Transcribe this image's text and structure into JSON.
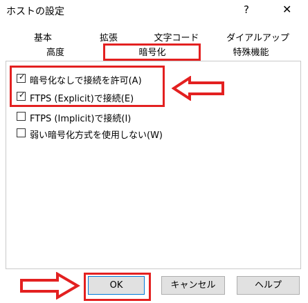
{
  "window": {
    "title": "ホストの設定",
    "help_label": "?",
    "close_label": "✕"
  },
  "tabs": {
    "row1": [
      "基本",
      "拡張",
      "文字コード",
      "ダイアルアップ"
    ],
    "row2": [
      "高度",
      "暗号化",
      "特殊機能"
    ],
    "active": "暗号化"
  },
  "options": [
    {
      "label": "暗号化なしで接続を許可(A)",
      "checked": true
    },
    {
      "label": "FTPS (Explicit)で接続(E)",
      "checked": true
    },
    {
      "label": "FTPS (Implicit)で接続(I)",
      "checked": false
    },
    {
      "label": "弱い暗号化方式を使用しない(W)",
      "checked": false
    }
  ],
  "buttons": {
    "ok": "OK",
    "cancel": "キャンセル",
    "help": "ヘルプ"
  },
  "annotation_color": "#e32020"
}
